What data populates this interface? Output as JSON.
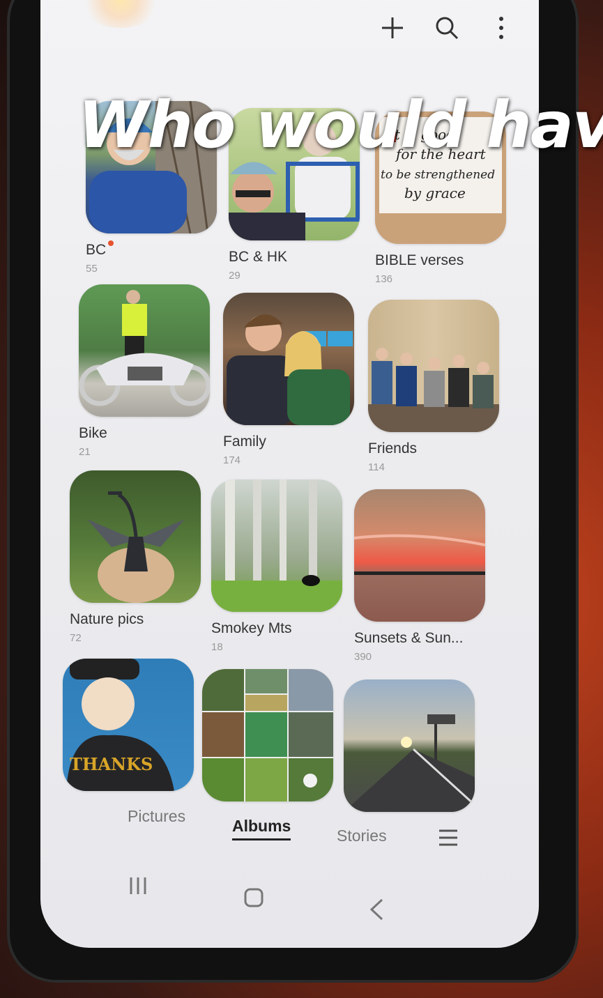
{
  "caption": "Who would hav",
  "topbar": {
    "add_icon": "plus-icon",
    "search_icon": "search-icon",
    "more_icon": "more-vertical-icon"
  },
  "albums": [
    {
      "name": "BC",
      "count": "55",
      "new_badge": true
    },
    {
      "name": "BC & HK",
      "count": "29"
    },
    {
      "name": "BIBLE verses",
      "count": "136",
      "thumb_text": [
        "It is good",
        "for the heart",
        "to be strengthened",
        "by grace"
      ]
    },
    {
      "name": "Bike",
      "count": "21"
    },
    {
      "name": "Family",
      "count": "174"
    },
    {
      "name": "Friends",
      "count": "114"
    },
    {
      "name": "Nature pics",
      "count": "72"
    },
    {
      "name": "Smokey Mts",
      "count": "18"
    },
    {
      "name": "Sunsets & Sun...",
      "count": "390"
    },
    {
      "name": "",
      "count": "",
      "thumb_text": [
        "THANKS"
      ]
    },
    {
      "name": "",
      "count": ""
    },
    {
      "name": "",
      "count": ""
    }
  ],
  "bottom_nav": {
    "pictures": "Pictures",
    "albums": "Albums",
    "stories": "Stories",
    "menu_icon": "hamburger-menu-icon"
  },
  "system_nav": {
    "recents": "recents-icon",
    "home": "home-icon",
    "back": "back-icon"
  },
  "colors": {
    "accent_dot": "#e6532f",
    "screen_bg": "#f0f0f3",
    "text": "#333333"
  }
}
